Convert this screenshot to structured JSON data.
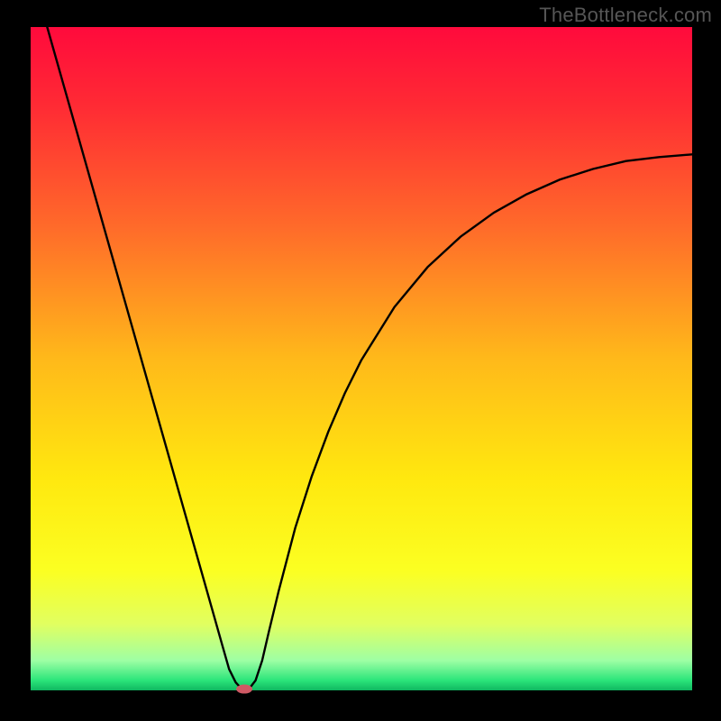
{
  "watermark": "TheBottleneck.com",
  "chart_data": {
    "type": "line",
    "title": "",
    "xlabel": "",
    "ylabel": "",
    "xlim": [
      0,
      100
    ],
    "ylim": [
      0,
      100
    ],
    "plot_area_bg_gradient": {
      "stops": [
        {
          "offset": 0.0,
          "color": "#ff0a3c"
        },
        {
          "offset": 0.12,
          "color": "#ff2b34"
        },
        {
          "offset": 0.3,
          "color": "#ff6a2a"
        },
        {
          "offset": 0.5,
          "color": "#ffb91a"
        },
        {
          "offset": 0.68,
          "color": "#ffe80f"
        },
        {
          "offset": 0.82,
          "color": "#fbff22"
        },
        {
          "offset": 0.9,
          "color": "#e1ff60"
        },
        {
          "offset": 0.955,
          "color": "#9effa4"
        },
        {
          "offset": 0.985,
          "color": "#2be57a"
        },
        {
          "offset": 1.0,
          "color": "#0fb760"
        }
      ]
    },
    "series": [
      {
        "name": "bottleneck-curve",
        "x": [
          2.5,
          5,
          7.5,
          10,
          12.5,
          15,
          17.5,
          20,
          22.5,
          25,
          27.5,
          29,
          30,
          31,
          32,
          33,
          34,
          35,
          36,
          37.5,
          40,
          42.5,
          45,
          47.5,
          50,
          55,
          60,
          65,
          70,
          75,
          80,
          85,
          90,
          95,
          100
        ],
        "y": [
          100,
          91.2,
          82.4,
          73.6,
          64.8,
          56,
          47.2,
          38.4,
          29.6,
          20.8,
          12,
          6.7,
          3.2,
          1.2,
          0.1,
          0.2,
          1.5,
          4.5,
          8.8,
          15,
          24.5,
          32.3,
          39,
          44.8,
          49.8,
          57.8,
          63.8,
          68.4,
          72,
          74.8,
          77,
          78.6,
          79.8,
          80.4,
          80.8
        ]
      }
    ],
    "marker": {
      "name": "optimal-point",
      "x": 32.3,
      "y": 0.2,
      "color": "#cf5964",
      "rx": 9,
      "ry": 5
    }
  },
  "layout": {
    "margin_left": 34,
    "margin_right": 32,
    "margin_top": 30,
    "margin_bottom": 34,
    "outer_width": 800,
    "outer_height": 800
  }
}
